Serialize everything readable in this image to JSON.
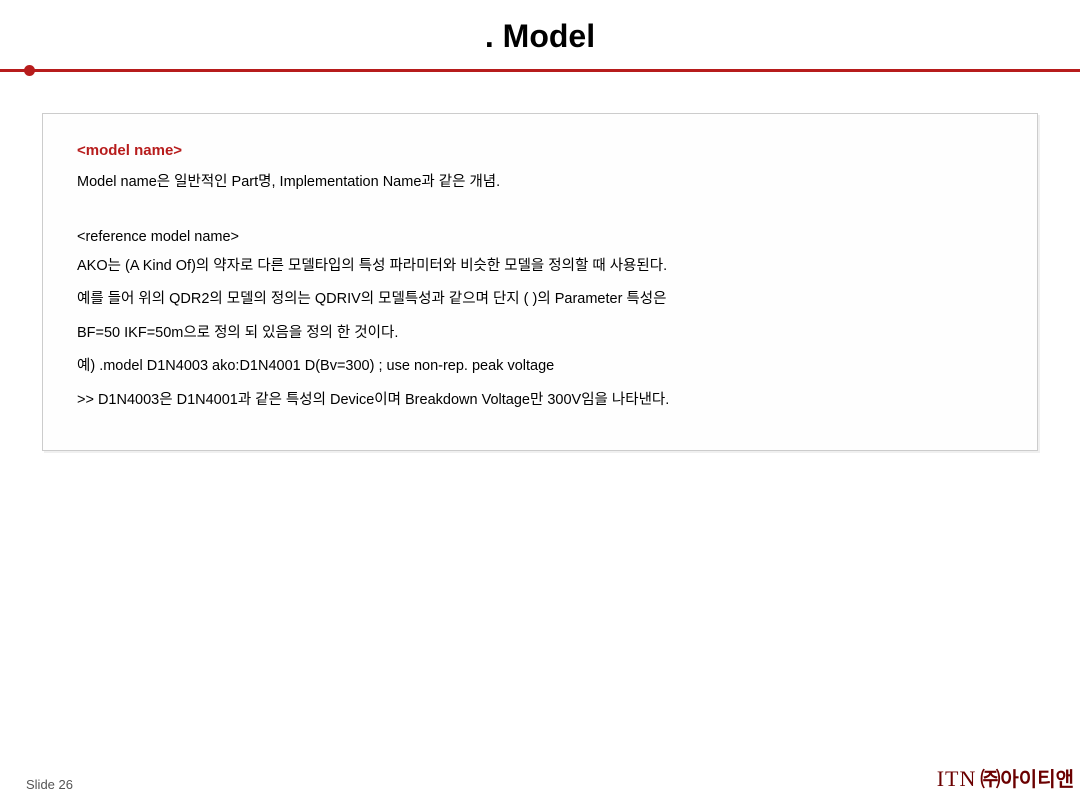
{
  "title": ". Model",
  "box": {
    "section1_head": "<model name>",
    "section1_body": "Model name은 일반적인 Part명, Implementation Name과 같은 개념.",
    "section2_head": "<reference model name>",
    "section2_lines": [
      "AKO는 (A Kind Of)의 약자로 다른 모델타입의 특성 파라미터와 비슷한 모델을 정의할 때 사용된다.",
      "예를 들어 위의 QDR2의 모델의 정의는 QDRIV의 모델특성과 같으며 단지 ( )의 Parameter 특성은",
      "BF=50 IKF=50m으로 정의 되 있음을 정의 한 것이다.",
      "예) .model D1N4003 ako:D1N4001 D(Bv=300)   ; use non-rep. peak voltage",
      ">> D1N4003은 D1N4001과 같은 특성의 Device이며 Breakdown Voltage만 300V임을 나타낸다."
    ]
  },
  "footer": {
    "slide": "Slide 26",
    "brand_itn": "ITN",
    "brand_ko": "㈜아이티앤"
  }
}
